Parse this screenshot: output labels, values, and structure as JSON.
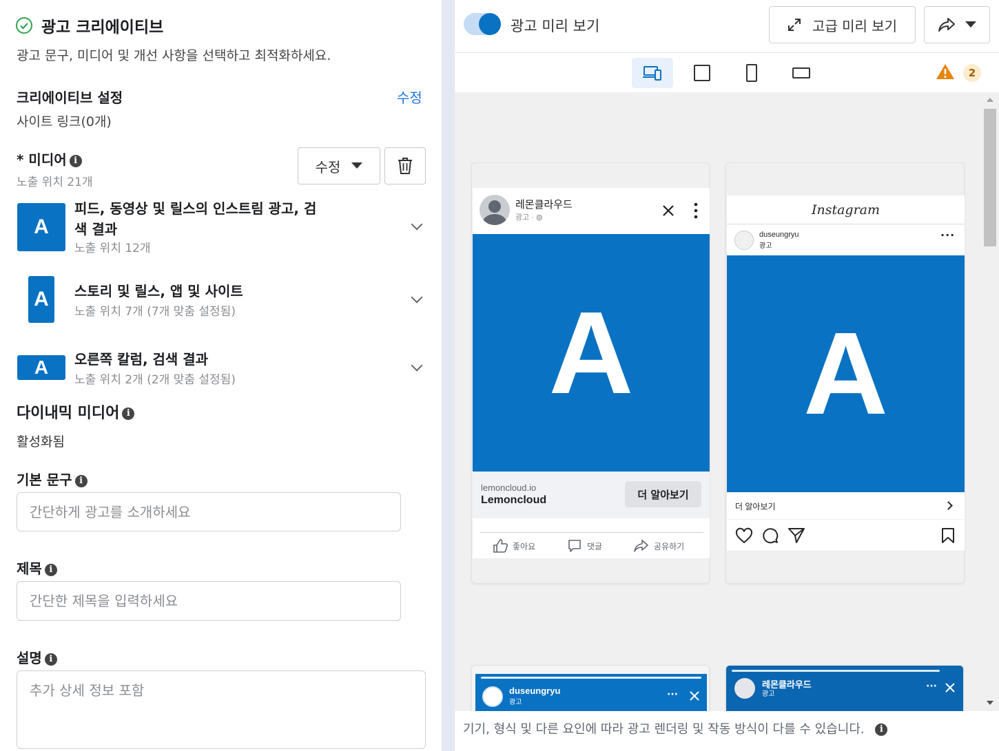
{
  "left": {
    "header": {
      "title": "광고 크리에이티브",
      "subtitle": "광고 문구, 미디어 및 개선 사항을 선택하고 최적화하세요."
    },
    "creative_settings": {
      "label": "크리에이티브 설정",
      "edit": "수정",
      "site_links": "사이트 링크(0개)"
    },
    "media": {
      "label": "* 미디어",
      "placements": "노출 위치 21개",
      "edit_button": "수정"
    },
    "placements": [
      {
        "thumb": "A",
        "title_line1": "피드, 동영상 및 릴스의 인스트림 광고, 검",
        "title_line2": "색 결과",
        "sub": "노출 위치 12개"
      },
      {
        "thumb": "A",
        "title": "스토리 및 릴스, 앱 및 사이트",
        "sub": "노출 위치 7개 (7개 맞춤 설정됨)"
      },
      {
        "thumb": "A",
        "title": "오른쪽 칼럼, 검색 결과",
        "sub": "노출 위치 2개 (2개 맞춤 설정됨)"
      }
    ],
    "dynamic_media": {
      "label": "다이내믹 미디어",
      "status": "활성화됨"
    },
    "primary_text": {
      "label": "기본 문구",
      "placeholder": "간단하게 광고를 소개하세요"
    },
    "headline": {
      "label": "제목",
      "placeholder": "간단한 제목을 입력하세요"
    },
    "description": {
      "label": "설명",
      "placeholder": "추가 상세 정보 포함"
    }
  },
  "right": {
    "preview_toggle_label": "광고 미리 보기",
    "advanced_preview": "고급 미리 보기",
    "warning_count": "2",
    "fb_card": {
      "page_name": "레몬클라우드",
      "sponsored": "광고 · ",
      "big_letter": "A",
      "domain": "lemoncloud.io",
      "brand": "Lemoncloud",
      "cta": "더 알아보기",
      "like": "좋아요",
      "comment": "댓글",
      "share": "공유하기"
    },
    "ig_card": {
      "logo": "Instagram",
      "username": "duseungryu",
      "sponsored": "광고",
      "big_letter": "A",
      "cta": "더 알아보기"
    },
    "story1": {
      "username": "duseungryu",
      "sponsored": "광고"
    },
    "story2": {
      "page_name": "레몬클라우드",
      "sponsored": "광고"
    },
    "footer_note": "기기, 형식 및 다른 요인에 따라 광고 렌더링 및 작동 방식이 다를 수 있습니다."
  },
  "colors": {
    "accent": "#0a72c2",
    "link": "#1b74e4",
    "warning": "#e8850c"
  }
}
